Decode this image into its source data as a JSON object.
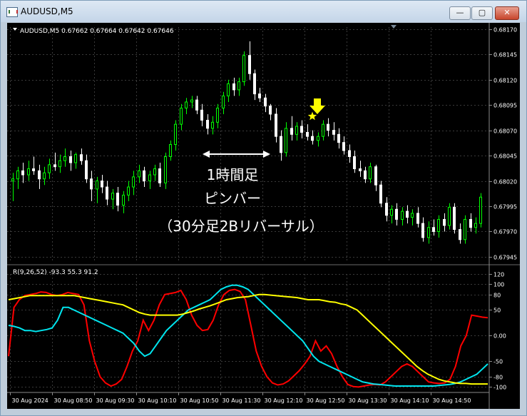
{
  "window": {
    "title": "AUDUSD,M5",
    "min_glyph": "—",
    "max_glyph": "▢",
    "close_glyph": "✕"
  },
  "price_panel": {
    "header": "AUDUSD,M5  0.67662 0.67664 0.67642 0.67646",
    "annotation_lines": [
      "1時間足",
      "ピンバー",
      "（30分足2Bリバーサル）"
    ],
    "marker_icon": "yellow-down-arrow-icon",
    "star_icon": "yellow-star-icon"
  },
  "osc_panel": {
    "header": "R(9,26,52) -93.3 55.3 91.2"
  },
  "colors": {
    "background": "#000000",
    "grid": "#3a3a3a",
    "bull": "#00ff00",
    "bear": "#ffffff",
    "annotation": "#ffffff",
    "marker": "#ffff00",
    "fast": "#ff0000",
    "mid": "#00e5ee",
    "slow": "#ffff00"
  },
  "chart_data": [
    {
      "type": "candlestick",
      "symbol": "AUDUSD",
      "timeframe": "M5",
      "ylim": [
        0.6794,
        0.68172
      ],
      "y_ticks": [
        "0.68170",
        "0.68145",
        "0.68120",
        "0.68095",
        "0.68070",
        "0.68045",
        "0.68020",
        "0.67995",
        "0.67970",
        "0.67945"
      ],
      "x_ticks": [
        "30 Aug 2024",
        "30 Aug 08:50",
        "30 Aug 09:30",
        "30 Aug 10:10",
        "30 Aug 10:50",
        "30 Aug 11:30",
        "30 Aug 12:10",
        "30 Aug 12:50",
        "30 Aug 13:30",
        "30 Aug 14:10",
        "30 Aug 14:50"
      ],
      "candles": [
        [
          0.6802,
          0.68028,
          0.68,
          0.68022
        ],
        [
          0.68022,
          0.68034,
          0.68012,
          0.6803
        ],
        [
          0.6803,
          0.68038,
          0.68018,
          0.68026
        ],
        [
          0.68026,
          0.6804,
          0.6802,
          0.68032
        ],
        [
          0.68032,
          0.68044,
          0.68026,
          0.6803
        ],
        [
          0.6803,
          0.68036,
          0.68012,
          0.68022
        ],
        [
          0.68022,
          0.68034,
          0.68016,
          0.68028
        ],
        [
          0.68028,
          0.68042,
          0.68022,
          0.68036
        ],
        [
          0.68036,
          0.68048,
          0.6803,
          0.68034
        ],
        [
          0.68034,
          0.68046,
          0.68028,
          0.6804
        ],
        [
          0.6804,
          0.68052,
          0.68034,
          0.68044
        ],
        [
          0.68044,
          0.6805,
          0.6803,
          0.68038
        ],
        [
          0.68038,
          0.68048,
          0.68032,
          0.68046
        ],
        [
          0.68046,
          0.68052,
          0.68036,
          0.6804
        ],
        [
          0.6804,
          0.68046,
          0.68018,
          0.68022
        ],
        [
          0.68022,
          0.6803,
          0.68,
          0.68012
        ],
        [
          0.68012,
          0.68024,
          0.67998,
          0.6802
        ],
        [
          0.6802,
          0.68026,
          0.68008,
          0.68014
        ],
        [
          0.68014,
          0.6802,
          0.67996,
          0.68002
        ],
        [
          0.68002,
          0.68012,
          0.67992,
          0.68008
        ],
        [
          0.68008,
          0.68014,
          0.6799,
          0.67996
        ],
        [
          0.67996,
          0.6801,
          0.67988,
          0.68006
        ],
        [
          0.68006,
          0.6802,
          0.68,
          0.68014
        ],
        [
          0.68014,
          0.6803,
          0.68006,
          0.68024
        ],
        [
          0.68024,
          0.68036,
          0.68018,
          0.6803
        ],
        [
          0.6803,
          0.68034,
          0.68014,
          0.6802
        ],
        [
          0.6802,
          0.6803,
          0.68012,
          0.68026
        ],
        [
          0.68026,
          0.68036,
          0.6802,
          0.68032
        ],
        [
          0.68032,
          0.68038,
          0.68014,
          0.68018
        ],
        [
          0.68018,
          0.68048,
          0.68012,
          0.68044
        ],
        [
          0.68044,
          0.6806,
          0.6804,
          0.68056
        ],
        [
          0.68056,
          0.6808,
          0.6805,
          0.68076
        ],
        [
          0.68076,
          0.68096,
          0.6807,
          0.68092
        ],
        [
          0.68092,
          0.68102,
          0.68086,
          0.68098
        ],
        [
          0.68098,
          0.68104,
          0.68092,
          0.681
        ],
        [
          0.681,
          0.68104,
          0.68086,
          0.6809
        ],
        [
          0.6809,
          0.68096,
          0.68074,
          0.6808
        ],
        [
          0.6808,
          0.68086,
          0.68066,
          0.68072
        ],
        [
          0.68072,
          0.68084,
          0.68066,
          0.68078
        ],
        [
          0.68078,
          0.68096,
          0.68072,
          0.68092
        ],
        [
          0.68092,
          0.68108,
          0.68086,
          0.68104
        ],
        [
          0.68104,
          0.6812,
          0.68098,
          0.68116
        ],
        [
          0.68116,
          0.68122,
          0.68104,
          0.6811
        ],
        [
          0.6811,
          0.68122,
          0.68104,
          0.68118
        ],
        [
          0.68118,
          0.68148,
          0.68114,
          0.68144
        ],
        [
          0.68144,
          0.68158,
          0.6812,
          0.68126
        ],
        [
          0.68126,
          0.6813,
          0.681,
          0.68106
        ],
        [
          0.68106,
          0.68112,
          0.68098,
          0.68102
        ],
        [
          0.68102,
          0.68106,
          0.68088,
          0.68094
        ],
        [
          0.68094,
          0.68096,
          0.6808,
          0.68086
        ],
        [
          0.68086,
          0.68092,
          0.68058,
          0.68064
        ],
        [
          0.68064,
          0.6807,
          0.6804,
          0.68048
        ],
        [
          0.68048,
          0.68078,
          0.68044,
          0.68072
        ],
        [
          0.68072,
          0.68084,
          0.6806,
          0.68066
        ],
        [
          0.68066,
          0.68078,
          0.6806,
          0.68074
        ],
        [
          0.68074,
          0.6808,
          0.68062,
          0.68068
        ],
        [
          0.68068,
          0.68076,
          0.6806,
          0.68064
        ],
        [
          0.68064,
          0.6807,
          0.68056,
          0.6806
        ],
        [
          0.6806,
          0.68068,
          0.68054,
          0.68064
        ],
        [
          0.68064,
          0.6808,
          0.6806,
          0.68076
        ],
        [
          0.68076,
          0.68082,
          0.68064,
          0.6807
        ],
        [
          0.6807,
          0.68078,
          0.6806,
          0.68066
        ],
        [
          0.68066,
          0.68072,
          0.68052,
          0.68058
        ],
        [
          0.68058,
          0.68064,
          0.68046,
          0.6805
        ],
        [
          0.6805,
          0.68056,
          0.68038,
          0.68044
        ],
        [
          0.68044,
          0.6805,
          0.68028,
          0.68032
        ],
        [
          0.68032,
          0.6804,
          0.68024,
          0.6803
        ],
        [
          0.6803,
          0.68034,
          0.68018,
          0.68022
        ],
        [
          0.68022,
          0.68038,
          0.68018,
          0.68034
        ],
        [
          0.68034,
          0.68036,
          0.6801,
          0.68016
        ],
        [
          0.68016,
          0.6802,
          0.67994,
          0.67998
        ],
        [
          0.67998,
          0.68004,
          0.6798,
          0.67986
        ],
        [
          0.67986,
          0.67996,
          0.67978,
          0.67992
        ],
        [
          0.67992,
          0.67998,
          0.67976,
          0.67982
        ],
        [
          0.67982,
          0.67994,
          0.67976,
          0.6799
        ],
        [
          0.6799,
          0.67996,
          0.67978,
          0.67984
        ],
        [
          0.67984,
          0.67992,
          0.67976,
          0.67988
        ],
        [
          0.67988,
          0.67994,
          0.67974,
          0.67978
        ],
        [
          0.67978,
          0.67984,
          0.6796,
          0.67964
        ],
        [
          0.67964,
          0.6798,
          0.67958,
          0.67974
        ],
        [
          0.67974,
          0.67982,
          0.67966,
          0.6797
        ],
        [
          0.6797,
          0.67986,
          0.67964,
          0.67982
        ],
        [
          0.67982,
          0.67988,
          0.6797,
          0.67976
        ],
        [
          0.67976,
          0.67998,
          0.67972,
          0.67994
        ],
        [
          0.67994,
          0.67998,
          0.67968,
          0.67972
        ],
        [
          0.67972,
          0.67978,
          0.67958,
          0.67962
        ],
        [
          0.67962,
          0.67986,
          0.67958,
          0.67982
        ],
        [
          0.67982,
          0.67988,
          0.6797,
          0.67974
        ],
        [
          0.67974,
          0.67984,
          0.67968,
          0.67978
        ],
        [
          0.67978,
          0.68008,
          0.67974,
          0.68004
        ]
      ]
    },
    {
      "type": "line",
      "name": "R(9,26,52)",
      "ylim": [
        -105,
        120
      ],
      "y_ticks": [
        120,
        100,
        80,
        50,
        0.0,
        -50,
        -80,
        -100
      ],
      "y_tick_labels": [
        "120",
        "100",
        "80",
        "50",
        "0.00",
        "-50",
        "-80",
        "-100"
      ],
      "last_values": [
        -93.3,
        55.3,
        91.2
      ],
      "series": [
        {
          "values": [
            -40,
            55,
            70,
            78,
            80,
            82,
            85,
            84,
            80,
            78,
            80,
            84,
            82,
            80,
            60,
            -10,
            -50,
            -80,
            -92,
            -98,
            -94,
            -85,
            -60,
            -30,
            -10,
            30,
            10,
            30,
            60,
            80,
            82,
            84,
            88,
            70,
            40,
            20,
            10,
            12,
            30,
            60,
            80,
            88,
            90,
            86,
            70,
            20,
            -30,
            -60,
            -80,
            -92,
            -96,
            -94,
            -88,
            -78,
            -68,
            -55,
            -40,
            -10,
            -30,
            -20,
            -35,
            -60,
            -80,
            -95,
            -99,
            -100,
            -98,
            -96,
            -95,
            -96,
            -90,
            -80,
            -70,
            -60,
            -55,
            -60,
            -70,
            -80,
            -90,
            -92,
            -93,
            -92,
            -85,
            -60,
            -20,
            0,
            40,
            38,
            36,
            35
          ]
        },
        {
          "values": [
            20,
            18,
            15,
            10,
            10,
            8,
            10,
            12,
            15,
            30,
            55,
            55,
            50,
            45,
            40,
            35,
            30,
            25,
            20,
            15,
            10,
            5,
            -5,
            -15,
            -30,
            -40,
            -35,
            -20,
            -5,
            10,
            20,
            30,
            40,
            50,
            55,
            60,
            65,
            70,
            80,
            90,
            95,
            98,
            98,
            95,
            90,
            80,
            70,
            60,
            50,
            40,
            30,
            20,
            10,
            0,
            -10,
            -25,
            -40,
            -50,
            -55,
            -60,
            -65,
            -70,
            -75,
            -80,
            -85,
            -90,
            -92,
            -94,
            -95,
            -96,
            -97,
            -98,
            -98,
            -98,
            -98,
            -98,
            -98,
            -98,
            -98,
            -97,
            -96,
            -95,
            -93,
            -90,
            -85,
            -80,
            -75,
            -65,
            -55
          ]
        },
        {
          "values": [
            70,
            72,
            74,
            76,
            78,
            78,
            78,
            78,
            78,
            78,
            78,
            78,
            78,
            76,
            74,
            72,
            70,
            68,
            66,
            64,
            62,
            60,
            55,
            50,
            45,
            42,
            40,
            40,
            40,
            40,
            40,
            40,
            42,
            45,
            48,
            52,
            55,
            58,
            62,
            66,
            70,
            72,
            74,
            75,
            76,
            78,
            80,
            80,
            79,
            78,
            77,
            76,
            75,
            74,
            72,
            70,
            70,
            70,
            68,
            66,
            65,
            62,
            60,
            55,
            50,
            40,
            30,
            20,
            10,
            0,
            -10,
            -20,
            -30,
            -40,
            -50,
            -60,
            -68,
            -75,
            -80,
            -85,
            -88,
            -90,
            -92,
            -93,
            -93,
            -94,
            -94,
            -94,
            -94
          ]
        }
      ]
    }
  ]
}
